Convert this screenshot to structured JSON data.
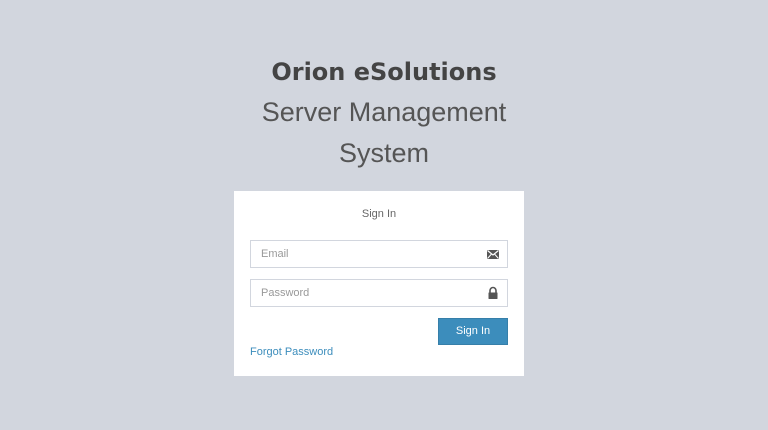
{
  "brand": {
    "title": "Orion eSolutions",
    "subtitle_line1": "Server Management",
    "subtitle_line2": "System"
  },
  "login_box": {
    "title": "Sign In",
    "email": {
      "placeholder": "Email",
      "value": "",
      "icon": "envelope-icon"
    },
    "password": {
      "placeholder": "Password",
      "value": "",
      "icon": "lock-icon"
    },
    "submit_label": "Sign In",
    "forgot_label": "Forgot Password"
  },
  "colors": {
    "background": "#d2d6de",
    "primary": "#3c8dbc",
    "box": "#ffffff"
  }
}
